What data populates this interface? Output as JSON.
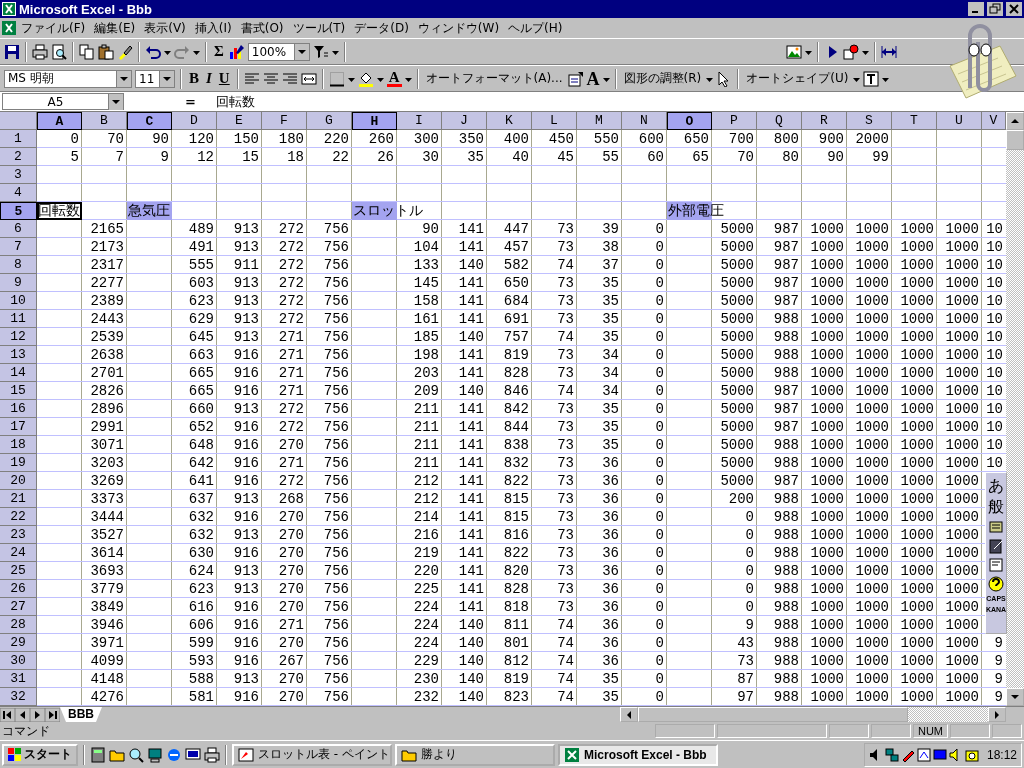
{
  "window": {
    "title": "Microsoft Excel - Bbb"
  },
  "menu": [
    "ファイル(F)",
    "編集(E)",
    "表示(V)",
    "挿入(I)",
    "書式(O)",
    "ツール(T)",
    "データ(D)",
    "ウィンドウ(W)",
    "ヘルプ(H)"
  ],
  "standard_toolbar": {
    "sum": "Σ",
    "zoom": "100%"
  },
  "format_toolbar": {
    "font": "MS 明朝",
    "size": "11",
    "bold": "B",
    "italic": "I",
    "underline": "U",
    "font_color": "A",
    "autoformat": "オートフォーマット(A)...",
    "grow_font": "A",
    "draw_adjust": "図形の調整(R)",
    "autoshape": "オートシェイプ(U)"
  },
  "formula_bar": {
    "name_box": "A5",
    "equals": "=",
    "formula": "回転数"
  },
  "sheet": {
    "columns": [
      {
        "label": "A",
        "selected": true
      },
      {
        "label": "B",
        "selected": false
      },
      {
        "label": "C",
        "selected": true
      },
      {
        "label": "D",
        "selected": false
      },
      {
        "label": "E",
        "selected": false
      },
      {
        "label": "F",
        "selected": false
      },
      {
        "label": "G",
        "selected": false
      },
      {
        "label": "H",
        "selected": true
      },
      {
        "label": "I",
        "selected": false
      },
      {
        "label": "J",
        "selected": false
      },
      {
        "label": "K",
        "selected": false
      },
      {
        "label": "L",
        "selected": false
      },
      {
        "label": "M",
        "selected": false
      },
      {
        "label": "N",
        "selected": false
      },
      {
        "label": "O",
        "selected": true
      },
      {
        "label": "P",
        "selected": false
      },
      {
        "label": "Q",
        "selected": false
      },
      {
        "label": "R",
        "selected": false
      },
      {
        "label": "S",
        "selected": false
      },
      {
        "label": "T",
        "selected": false
      },
      {
        "label": "U",
        "selected": false
      },
      {
        "label": "V",
        "selected": false
      }
    ],
    "rows": [
      {
        "number": "1",
        "selected": false,
        "cells": [
          "0",
          "70",
          "90",
          "120",
          "150",
          "180",
          "220",
          "260",
          "300",
          "350",
          "400",
          "450",
          "550",
          "600",
          "650",
          "700",
          "800",
          "900",
          "2000",
          null,
          null,
          null
        ]
      },
      {
        "number": "2",
        "selected": false,
        "cells": [
          "5",
          "7",
          "9",
          "12",
          "15",
          "18",
          "22",
          "26",
          "30",
          "35",
          "40",
          "45",
          "55",
          "60",
          "65",
          "70",
          "80",
          "90",
          "99",
          null,
          null,
          null
        ]
      },
      {
        "number": "3",
        "selected": false,
        "cells": [
          null,
          null,
          null,
          null,
          null,
          null,
          null,
          null,
          null,
          null,
          null,
          null,
          null,
          null,
          null,
          null,
          null,
          null,
          null,
          null,
          null,
          null
        ]
      },
      {
        "number": "4",
        "selected": false,
        "cells": [
          null,
          null,
          null,
          null,
          null,
          null,
          null,
          null,
          null,
          null,
          null,
          null,
          null,
          null,
          null,
          null,
          null,
          null,
          null,
          null,
          null,
          null
        ]
      },
      {
        "number": "5",
        "selected": true,
        "cells": [
          {
            "text": "回転数",
            "selected": false,
            "active": true
          },
          null,
          {
            "text": "急気圧",
            "selected": true,
            "active": false
          },
          null,
          null,
          null,
          null,
          {
            "text": "スロットル",
            "selected": true,
            "active": false
          },
          null,
          null,
          null,
          null,
          null,
          null,
          {
            "text": "外部電圧",
            "selected": true,
            "active": false
          },
          null,
          null,
          null,
          null,
          null,
          null,
          null
        ]
      },
      {
        "number": "6",
        "selected": false,
        "cells": [
          null,
          "2165",
          null,
          "489",
          "913",
          "272",
          "756",
          null,
          "90",
          "141",
          "447",
          "73",
          "39",
          "0",
          null,
          "5000",
          "987",
          "1000",
          "1000",
          "1000",
          "1000",
          "10"
        ]
      },
      {
        "number": "7",
        "selected": false,
        "cells": [
          null,
          "2173",
          null,
          "491",
          "913",
          "272",
          "756",
          null,
          "104",
          "141",
          "457",
          "73",
          "38",
          "0",
          null,
          "5000",
          "987",
          "1000",
          "1000",
          "1000",
          "1000",
          "10"
        ]
      },
      {
        "number": "8",
        "selected": false,
        "cells": [
          null,
          "2317",
          null,
          "555",
          "911",
          "272",
          "756",
          null,
          "133",
          "140",
          "582",
          "74",
          "37",
          "0",
          null,
          "5000",
          "987",
          "1000",
          "1000",
          "1000",
          "1000",
          "10"
        ]
      },
      {
        "number": "9",
        "selected": false,
        "cells": [
          null,
          "2277",
          null,
          "603",
          "913",
          "272",
          "756",
          null,
          "145",
          "141",
          "650",
          "73",
          "35",
          "0",
          null,
          "5000",
          "987",
          "1000",
          "1000",
          "1000",
          "1000",
          "10"
        ]
      },
      {
        "number": "10",
        "selected": false,
        "cells": [
          null,
          "2389",
          null,
          "623",
          "913",
          "272",
          "756",
          null,
          "158",
          "141",
          "684",
          "73",
          "35",
          "0",
          null,
          "5000",
          "987",
          "1000",
          "1000",
          "1000",
          "1000",
          "10"
        ]
      },
      {
        "number": "11",
        "selected": false,
        "cells": [
          null,
          "2443",
          null,
          "629",
          "913",
          "272",
          "756",
          null,
          "161",
          "141",
          "691",
          "73",
          "35",
          "0",
          null,
          "5000",
          "988",
          "1000",
          "1000",
          "1000",
          "1000",
          "10"
        ]
      },
      {
        "number": "12",
        "selected": false,
        "cells": [
          null,
          "2539",
          null,
          "645",
          "913",
          "271",
          "756",
          null,
          "185",
          "140",
          "757",
          "74",
          "35",
          "0",
          null,
          "5000",
          "988",
          "1000",
          "1000",
          "1000",
          "1000",
          "10"
        ]
      },
      {
        "number": "13",
        "selected": false,
        "cells": [
          null,
          "2638",
          null,
          "663",
          "916",
          "271",
          "756",
          null,
          "198",
          "141",
          "819",
          "73",
          "34",
          "0",
          null,
          "5000",
          "988",
          "1000",
          "1000",
          "1000",
          "1000",
          "10"
        ]
      },
      {
        "number": "14",
        "selected": false,
        "cells": [
          null,
          "2701",
          null,
          "665",
          "916",
          "271",
          "756",
          null,
          "203",
          "141",
          "828",
          "73",
          "34",
          "0",
          null,
          "5000",
          "988",
          "1000",
          "1000",
          "1000",
          "1000",
          "10"
        ]
      },
      {
        "number": "15",
        "selected": false,
        "cells": [
          null,
          "2826",
          null,
          "665",
          "916",
          "271",
          "756",
          null,
          "209",
          "140",
          "846",
          "74",
          "34",
          "0",
          null,
          "5000",
          "987",
          "1000",
          "1000",
          "1000",
          "1000",
          "10"
        ]
      },
      {
        "number": "16",
        "selected": false,
        "cells": [
          null,
          "2896",
          null,
          "660",
          "913",
          "272",
          "756",
          null,
          "211",
          "141",
          "842",
          "73",
          "35",
          "0",
          null,
          "5000",
          "987",
          "1000",
          "1000",
          "1000",
          "1000",
          "10"
        ]
      },
      {
        "number": "17",
        "selected": false,
        "cells": [
          null,
          "2991",
          null,
          "652",
          "916",
          "272",
          "756",
          null,
          "211",
          "141",
          "844",
          "73",
          "35",
          "0",
          null,
          "5000",
          "987",
          "1000",
          "1000",
          "1000",
          "1000",
          "10"
        ]
      },
      {
        "number": "18",
        "selected": false,
        "cells": [
          null,
          "3071",
          null,
          "648",
          "916",
          "270",
          "756",
          null,
          "211",
          "141",
          "838",
          "73",
          "35",
          "0",
          null,
          "5000",
          "988",
          "1000",
          "1000",
          "1000",
          "1000",
          "10"
        ]
      },
      {
        "number": "19",
        "selected": false,
        "cells": [
          null,
          "3203",
          null,
          "642",
          "916",
          "271",
          "756",
          null,
          "211",
          "141",
          "832",
          "73",
          "36",
          "0",
          null,
          "5000",
          "988",
          "1000",
          "1000",
          "1000",
          "1000",
          "10"
        ]
      },
      {
        "number": "20",
        "selected": false,
        "cells": [
          null,
          "3269",
          null,
          "641",
          "916",
          "272",
          "756",
          null,
          "212",
          "141",
          "822",
          "73",
          "36",
          "0",
          null,
          "5000",
          "987",
          "1000",
          "1000",
          "1000",
          "1000",
          null
        ]
      },
      {
        "number": "21",
        "selected": false,
        "cells": [
          null,
          "3373",
          null,
          "637",
          "913",
          "268",
          "756",
          null,
          "212",
          "141",
          "815",
          "73",
          "36",
          "0",
          null,
          "200",
          "988",
          "1000",
          "1000",
          "1000",
          "1000",
          null
        ]
      },
      {
        "number": "22",
        "selected": false,
        "cells": [
          null,
          "3444",
          null,
          "632",
          "916",
          "270",
          "756",
          null,
          "214",
          "141",
          "815",
          "73",
          "36",
          "0",
          null,
          "0",
          "988",
          "1000",
          "1000",
          "1000",
          "1000",
          null
        ]
      },
      {
        "number": "23",
        "selected": false,
        "cells": [
          null,
          "3527",
          null,
          "632",
          "913",
          "270",
          "756",
          null,
          "216",
          "141",
          "816",
          "73",
          "36",
          "0",
          null,
          "0",
          "988",
          "1000",
          "1000",
          "1000",
          "1000",
          null
        ]
      },
      {
        "number": "24",
        "selected": false,
        "cells": [
          null,
          "3614",
          null,
          "630",
          "916",
          "270",
          "756",
          null,
          "219",
          "141",
          "822",
          "73",
          "36",
          "0",
          null,
          "0",
          "988",
          "1000",
          "1000",
          "1000",
          "1000",
          null
        ]
      },
      {
        "number": "25",
        "selected": false,
        "cells": [
          null,
          "3693",
          null,
          "624",
          "913",
          "270",
          "756",
          null,
          "220",
          "141",
          "820",
          "73",
          "36",
          "0",
          null,
          "0",
          "988",
          "1000",
          "1000",
          "1000",
          "1000",
          null
        ]
      },
      {
        "number": "26",
        "selected": false,
        "cells": [
          null,
          "3779",
          null,
          "623",
          "913",
          "270",
          "756",
          null,
          "225",
          "141",
          "828",
          "73",
          "36",
          "0",
          null,
          "0",
          "988",
          "1000",
          "1000",
          "1000",
          "1000",
          null
        ]
      },
      {
        "number": "27",
        "selected": false,
        "cells": [
          null,
          "3849",
          null,
          "616",
          "916",
          "270",
          "756",
          null,
          "224",
          "141",
          "818",
          "73",
          "36",
          "0",
          null,
          "0",
          "988",
          "1000",
          "1000",
          "1000",
          "1000",
          null
        ]
      },
      {
        "number": "28",
        "selected": false,
        "cells": [
          null,
          "3946",
          null,
          "606",
          "916",
          "271",
          "756",
          null,
          "224",
          "140",
          "811",
          "74",
          "36",
          "0",
          null,
          "9",
          "988",
          "1000",
          "1000",
          "1000",
          "1000",
          null
        ]
      },
      {
        "number": "29",
        "selected": false,
        "cells": [
          null,
          "3971",
          null,
          "599",
          "916",
          "270",
          "756",
          null,
          "224",
          "140",
          "801",
          "74",
          "36",
          "0",
          null,
          "43",
          "988",
          "1000",
          "1000",
          "1000",
          "1000",
          "9"
        ]
      },
      {
        "number": "30",
        "selected": false,
        "cells": [
          null,
          "4099",
          null,
          "593",
          "916",
          "267",
          "756",
          null,
          "229",
          "140",
          "812",
          "74",
          "36",
          "0",
          null,
          "73",
          "988",
          "1000",
          "1000",
          "1000",
          "1000",
          "9"
        ]
      },
      {
        "number": "31",
        "selected": false,
        "cells": [
          null,
          "4148",
          null,
          "588",
          "913",
          "270",
          "756",
          null,
          "230",
          "140",
          "819",
          "74",
          "35",
          "0",
          null,
          "87",
          "988",
          "1000",
          "1000",
          "1000",
          "1000",
          "9"
        ]
      },
      {
        "number": "32",
        "selected": false,
        "cells": [
          null,
          "4276",
          null,
          "581",
          "916",
          "270",
          "756",
          null,
          "232",
          "140",
          "823",
          "74",
          "35",
          "0",
          null,
          "97",
          "988",
          "1000",
          "1000",
          "1000",
          "1000",
          "9"
        ]
      }
    ]
  },
  "sheet_tabs": [
    {
      "label": "BBB",
      "selected": true
    }
  ],
  "status_bar": {
    "message": "コマンド",
    "num": "NUM"
  },
  "ime_bar": {
    "mode": "あ",
    "conversion": "般",
    "caps": "CAPS",
    "kana": "KANA"
  },
  "taskbar": {
    "start": "スタート",
    "tasks": [
      {
        "label": "スロットル表 - ペイント",
        "selected": false,
        "kind": "paint"
      },
      {
        "label": "勝より",
        "selected": false,
        "kind": "folder"
      },
      {
        "label": "Microsoft Excel - Bbb",
        "selected": true,
        "kind": "excel"
      }
    ],
    "clock": "18:12"
  }
}
